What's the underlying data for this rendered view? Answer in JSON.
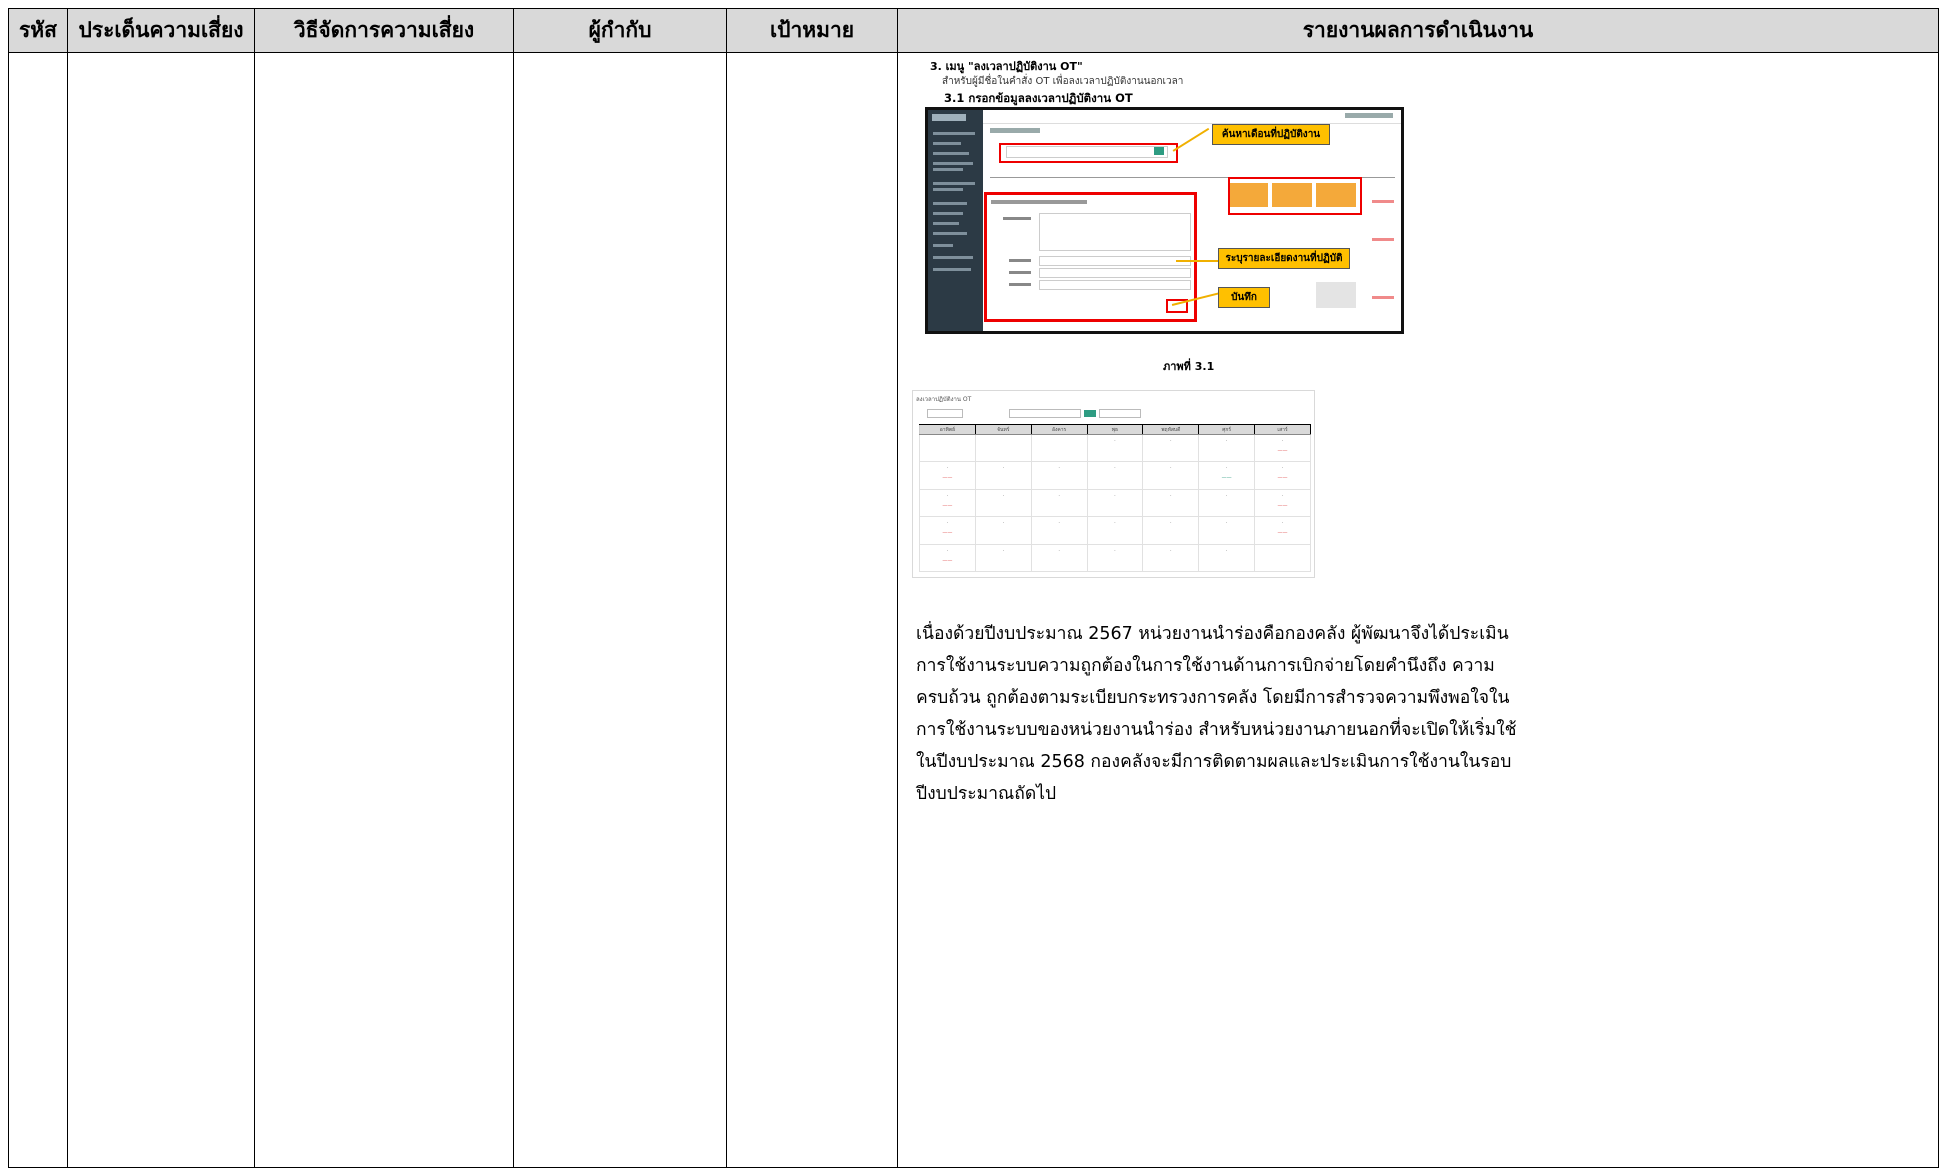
{
  "table": {
    "headers": {
      "code": "รหัส",
      "risk_issue": "ประเด็นความเสี่ยง",
      "risk_management": "วิธีจัดการความเสี่ยง",
      "supervisor": "ผู้กำกับ",
      "target": "เป้าหมาย",
      "report": "รายงานผลการดำเนินงาน"
    }
  },
  "report": {
    "menu_heading": "3.  เมนู \"ลงเวลาปฏิบัติงาน OT\"",
    "menu_subtext": "สำหรับผู้มีชื่อในคำสั่ง OT เพื่อลงเวลาปฏิบัติงานนอกเวลา",
    "step_heading": "3.1 กรอกข้อมูลลงเวลาปฏิบัติงาน OT",
    "callouts": {
      "search_month": "ค้นหาเดือนที่ปฏิบัติงาน",
      "specify_details": "ระบุรายละเอียดงานที่ปฏิบัติ",
      "save": "บันทึก"
    },
    "figure_caption": "ภาพที่ 3.1",
    "screenshot2_title": "ลงเวลาปฏิบัติงาน OT",
    "weekdays": [
      "อาทิตย์",
      "จันทร์",
      "อังคาร",
      "พุธ",
      "พฤหัสบดี",
      "ศุกร์",
      "เสาร์"
    ],
    "paragraph_lines": [
      "เนื่องด้วยปีงบประมาณ 2567 หน่วยงานนำร่องคือกองคลัง ผู้พัฒนาจึงได้ประเมิน",
      "การใช้งานระบบความถูกต้องในการใช้งานด้านการเบิกจ่ายโดยคำนึงถึง ความ",
      "ครบถ้วน ถูกต้องตามระเบียบกระทรวงการคลัง โดยมีการสำรวจความพึงพอใจใน",
      "การใช้งานระบบของหน่วยงานนำร่อง สำหรับหน่วยงานภายนอกที่จะเปิดให้เริ่มใช้",
      "ในปีงบประมาณ 2568 กองคลังจะมีการติดตามผลและประเมินการใช้งานในรอบ",
      "ปีงบประมาณถัดไป"
    ]
  }
}
